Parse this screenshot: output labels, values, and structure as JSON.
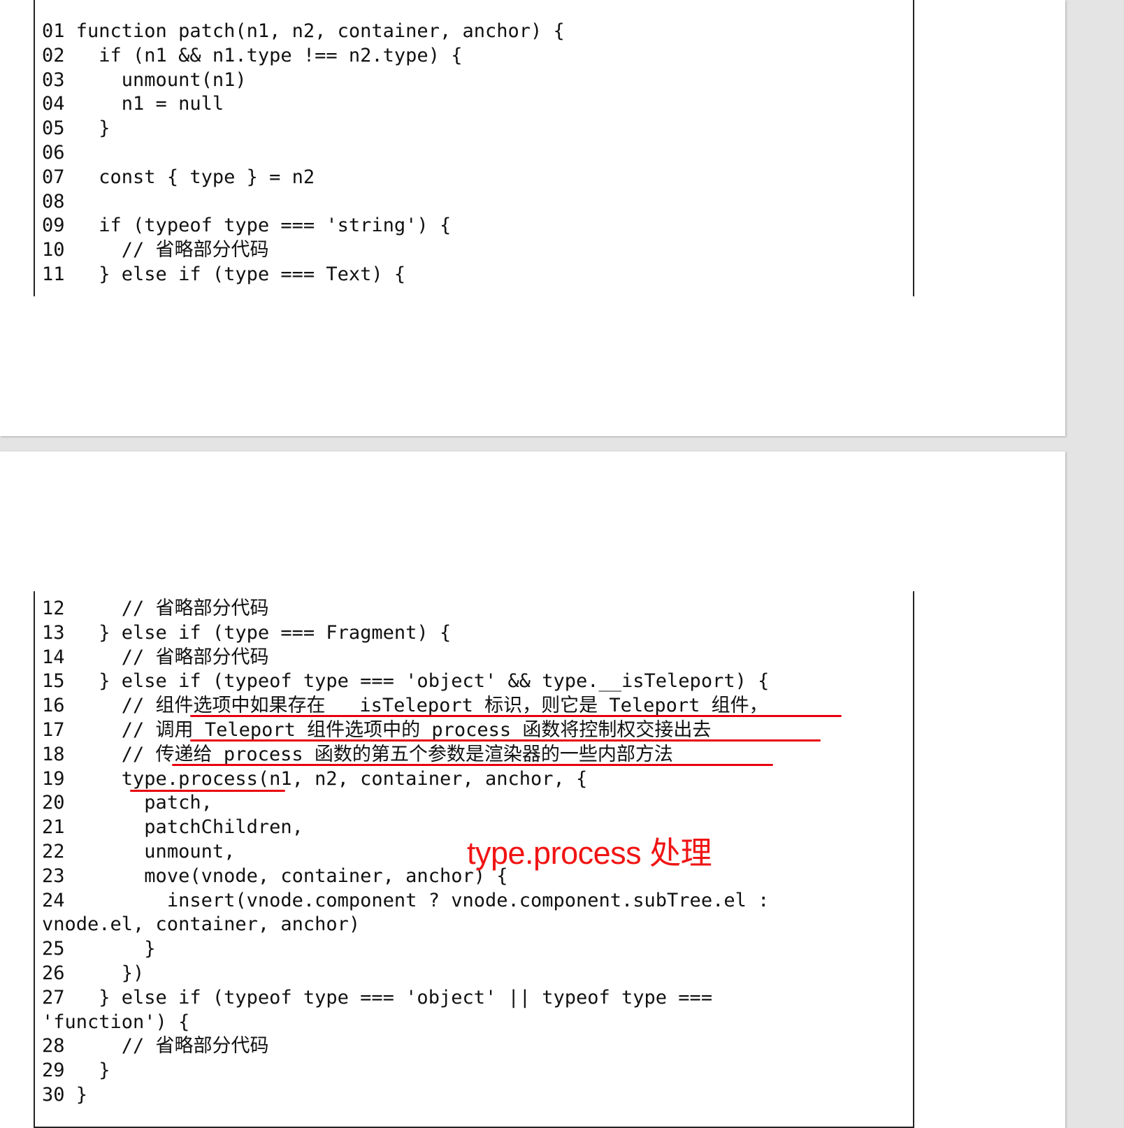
{
  "page1": {
    "lines": [
      {
        "no": "01",
        "code": " function patch(n1, n2, container, anchor) {"
      },
      {
        "no": "02",
        "code": "   if (n1 && n1.type !== n2.type) {"
      },
      {
        "no": "03",
        "code": "     unmount(n1)"
      },
      {
        "no": "04",
        "code": "     n1 = null"
      },
      {
        "no": "05",
        "code": "   }"
      },
      {
        "no": "06",
        "code": ""
      },
      {
        "no": "07",
        "code": "   const { type } = n2"
      },
      {
        "no": "08",
        "code": ""
      },
      {
        "no": "09",
        "code": "   if (typeof type === 'string') {"
      },
      {
        "no": "10",
        "code": "     // 省略部分代码"
      },
      {
        "no": "11",
        "code": "   } else if (type === Text) {"
      }
    ]
  },
  "page2": {
    "lines": [
      {
        "no": "12",
        "code": "     // 省略部分代码"
      },
      {
        "no": "13",
        "code": "   } else if (type === Fragment) {"
      },
      {
        "no": "14",
        "code": "     // 省略部分代码"
      },
      {
        "no": "15",
        "code": "   } else if (typeof type === 'object' && type.__isTeleport) {"
      },
      {
        "no": "16",
        "code": "     // 组件选项中如果存在 __isTeleport 标识，则它是 Teleport 组件，"
      },
      {
        "no": "17",
        "code": "     // 调用 Teleport 组件选项中的 process 函数将控制权交接出去"
      },
      {
        "no": "18",
        "code": "     // 传递给 process 函数的第五个参数是渲染器的一些内部方法"
      },
      {
        "no": "19",
        "code": "     type.process(n1, n2, container, anchor, {"
      },
      {
        "no": "20",
        "code": "       patch,"
      },
      {
        "no": "21",
        "code": "       patchChildren,"
      },
      {
        "no": "22",
        "code": "       unmount,"
      },
      {
        "no": "23",
        "code": "       move(vnode, container, anchor) {"
      },
      {
        "no": "24",
        "code": "         insert(vnode.component ? vnode.component.subTree.el :"
      },
      {
        "no": "",
        "code": "vnode.el, container, anchor)"
      },
      {
        "no": "25",
        "code": "       }"
      },
      {
        "no": "26",
        "code": "     })"
      },
      {
        "no": "27",
        "code": "   } else if (typeof type === 'object' || typeof type ==="
      },
      {
        "no": "",
        "code": "'function') {"
      },
      {
        "no": "28",
        "code": "     // 省略部分代码"
      },
      {
        "no": "29",
        "code": "   }"
      },
      {
        "no": "30",
        "code": " }"
      }
    ]
  },
  "annotation": {
    "text": "type.process 处理",
    "color": "#f01414"
  },
  "underline_color": "#e8000f"
}
